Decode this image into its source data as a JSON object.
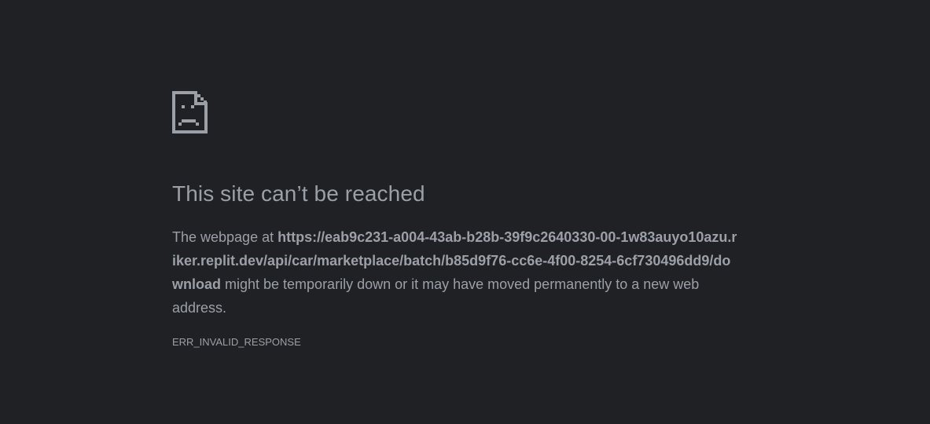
{
  "error_page": {
    "icon": "sad-document-icon",
    "title": "This site can’t be reached",
    "message_prefix": "The webpage at ",
    "url": "https://eab9c231-a004-43ab-b28b-39f9c2640330-00-1w83auyo10azu.riker.replit.dev/api/car/marketplace/batch/b85d9f76-cc6e-4f00-8254-6cf730496dd9/download",
    "message_suffix": " might be temporarily down or it may have moved permanently to a new web address.",
    "error_code": "ERR_INVALID_RESPONSE"
  },
  "colors": {
    "background": "#202124",
    "text": "#9aa0a6"
  }
}
